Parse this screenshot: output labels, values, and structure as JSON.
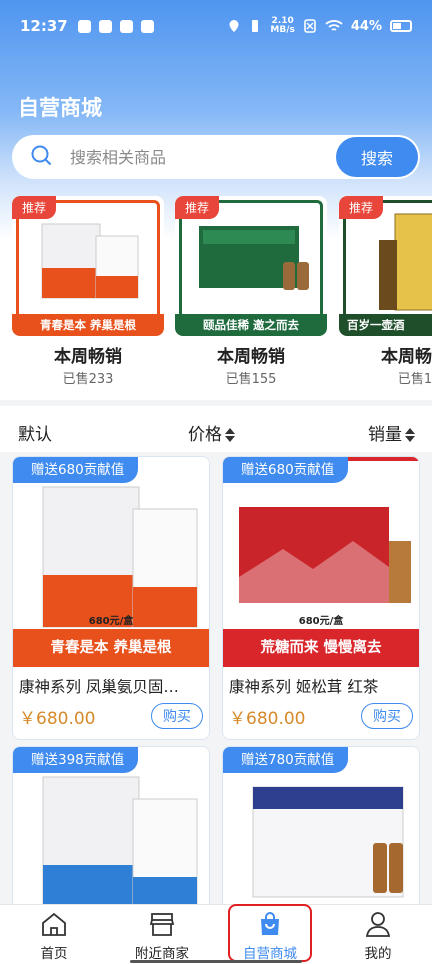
{
  "status": {
    "time": "12:37",
    "network_speed_top": "2.10",
    "network_speed_bottom": "MB/s",
    "battery": "44%"
  },
  "header": {
    "title": "自营商城"
  },
  "search": {
    "placeholder": "搜索相关商品",
    "button": "搜索"
  },
  "hot": [
    {
      "tag": "推荐",
      "title": "本周畅销",
      "sold": "已售233",
      "banner": "青春是本 养巢是根",
      "accent": "#e8501c"
    },
    {
      "tag": "推荐",
      "title": "本周畅销",
      "sold": "已售155",
      "banner": "颐品佳稀 邀之而去",
      "accent": "#1f6b3d"
    },
    {
      "tag": "推荐",
      "title": "本周畅销",
      "sold": "已售1",
      "banner": "百岁一壶酒",
      "accent": "#1f4f2a"
    }
  ],
  "sort": {
    "default": "默认",
    "price": "价格",
    "sales": "销量"
  },
  "products": [
    {
      "gift": "赠送680贡献值",
      "banner": "青春是本 养巢是根",
      "price_label": "680元/盒",
      "name": "康神系列 凤巢氨贝固…",
      "price": "￥680.00",
      "buy": "购买",
      "accent": "#e8501c"
    },
    {
      "gift": "赠送680贡献值",
      "banner": "荒糖而来 慢慢离去",
      "price_label": "680元/盒",
      "name": "康神系列 姬松茸 红茶",
      "price": "￥680.00",
      "buy": "购买",
      "accent": "#d8262b"
    },
    {
      "gift": "赠送398贡献值",
      "accent": "#2f7fd6"
    },
    {
      "gift": "赠送780贡献值",
      "accent": "#2f3f8f"
    }
  ],
  "tabs": [
    {
      "label": "首页"
    },
    {
      "label": "附近商家"
    },
    {
      "label": "自营商城"
    },
    {
      "label": "我的"
    }
  ],
  "colors": {
    "primary": "#3f8bef",
    "price": "#d68a2a",
    "highlight": "#e02020"
  }
}
